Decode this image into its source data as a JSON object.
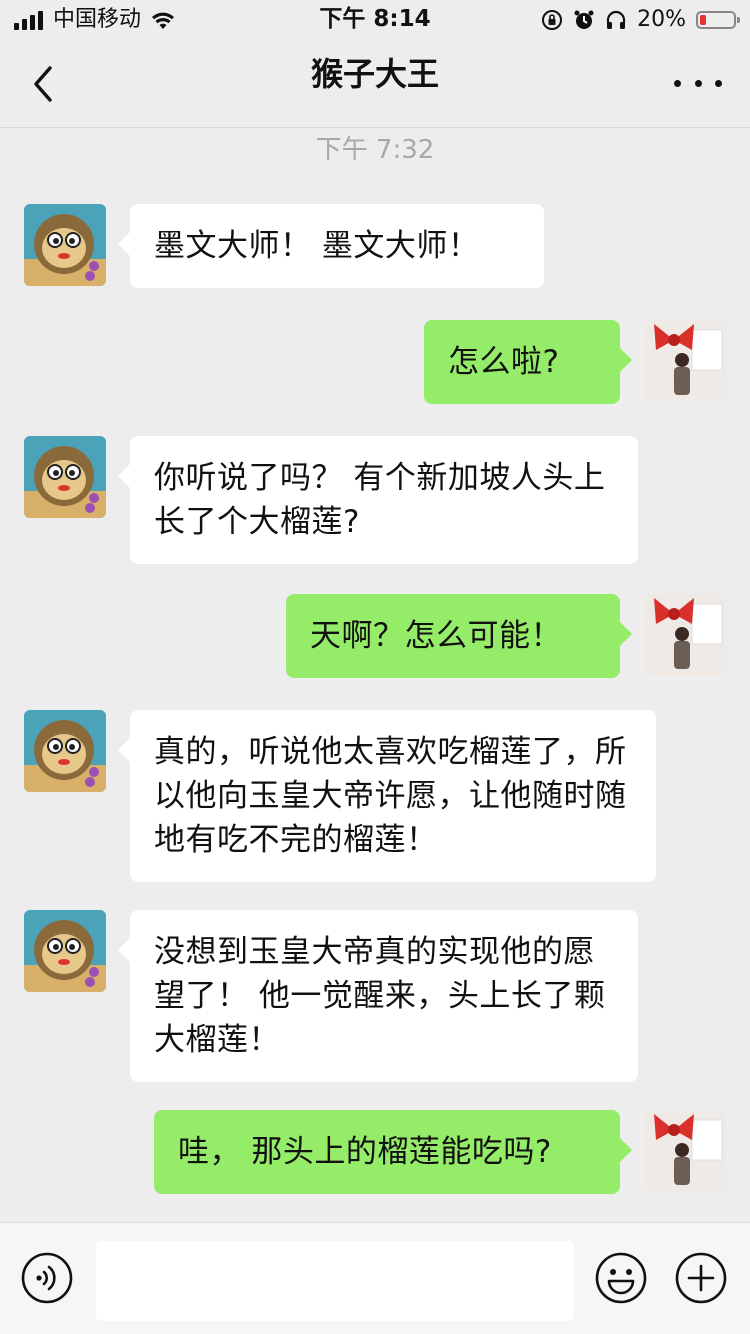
{
  "status_bar": {
    "carrier": "中国移动",
    "time": "下午 8:14",
    "battery_percent": "20%",
    "battery_level": 0.2,
    "battery_color": "#e33333",
    "icons": [
      "signal-icon",
      "wifi-icon",
      "orientation-lock-icon",
      "alarm-icon",
      "headphones-icon",
      "battery-icon"
    ]
  },
  "nav": {
    "title": "猴子大王",
    "back_icon": "chevron-left-icon",
    "more_icon": "more-icon"
  },
  "timestamp": "下午 7:32",
  "messages": [
    {
      "side": "recv",
      "text": "墨文大师！ 墨文大师！"
    },
    {
      "side": "sent",
      "text": "怎么啦?"
    },
    {
      "side": "recv",
      "text": "你听说了吗？ 有个新加坡人头上长了个大榴莲?"
    },
    {
      "side": "sent",
      "text": "天啊？怎么可能！"
    },
    {
      "side": "recv",
      "text": "真的，听说他太喜欢吃榴莲了，所以他向玉皇大帝许愿，让他随时随地有吃不完的榴莲！"
    },
    {
      "side": "recv",
      "text": "没想到玉皇大帝真的实现他的愿望了！ 他一觉醒来，头上长了颗大榴莲！"
    },
    {
      "side": "sent",
      "text": "哇， 那头上的榴莲能吃吗?"
    }
  ],
  "input_bar": {
    "value": "",
    "icons": [
      "voice-icon",
      "emoji-icon",
      "plus-icon"
    ]
  },
  "colors": {
    "background": "#ededed",
    "sent_bubble": "#95ec69",
    "recv_bubble": "#ffffff"
  }
}
